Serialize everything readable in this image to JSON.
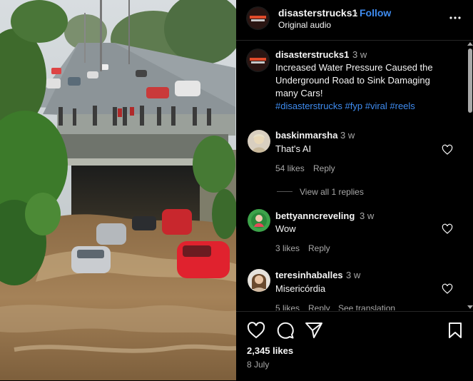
{
  "post": {
    "username": "disasterstrucks1",
    "follow_sep": "•",
    "follow_label": "Follow",
    "audio": "Original audio",
    "logo_text": "DISASTER STRUCKS",
    "caption_username": "disasterstrucks1",
    "caption_age": "3 w",
    "caption_text_lines": [
      "Increased Water Pressure Caused the",
      "Underground Road to Sink Damaging",
      "many Cars!"
    ],
    "hashtags": "#disasterstrucks #fyp #viral #reels"
  },
  "comments": [
    {
      "username": "baskinmarsha",
      "age": "3 w",
      "text": "That's AI",
      "likes": "54 likes",
      "reply": "Reply",
      "view_replies": "View all 1 replies"
    },
    {
      "username": "bettyanncreveling",
      "age": "3 w",
      "text": "Wow",
      "likes": "3 likes",
      "reply": "Reply"
    },
    {
      "username": "teresinhaballes",
      "age": "3 w",
      "text": "Misericórdia",
      "likes": "5 likes",
      "reply": "Reply",
      "see_translation": "See translation"
    }
  ],
  "footer": {
    "likes": "2,345 likes",
    "date": "8 July"
  },
  "icons": {
    "more": "more-options-icon",
    "like": "heart-icon",
    "comment": "comment-icon",
    "share": "send-icon",
    "save": "bookmark-icon"
  },
  "colors": {
    "background": "#000000",
    "link": "#3f8cf0",
    "muted": "#a8a8a8"
  }
}
